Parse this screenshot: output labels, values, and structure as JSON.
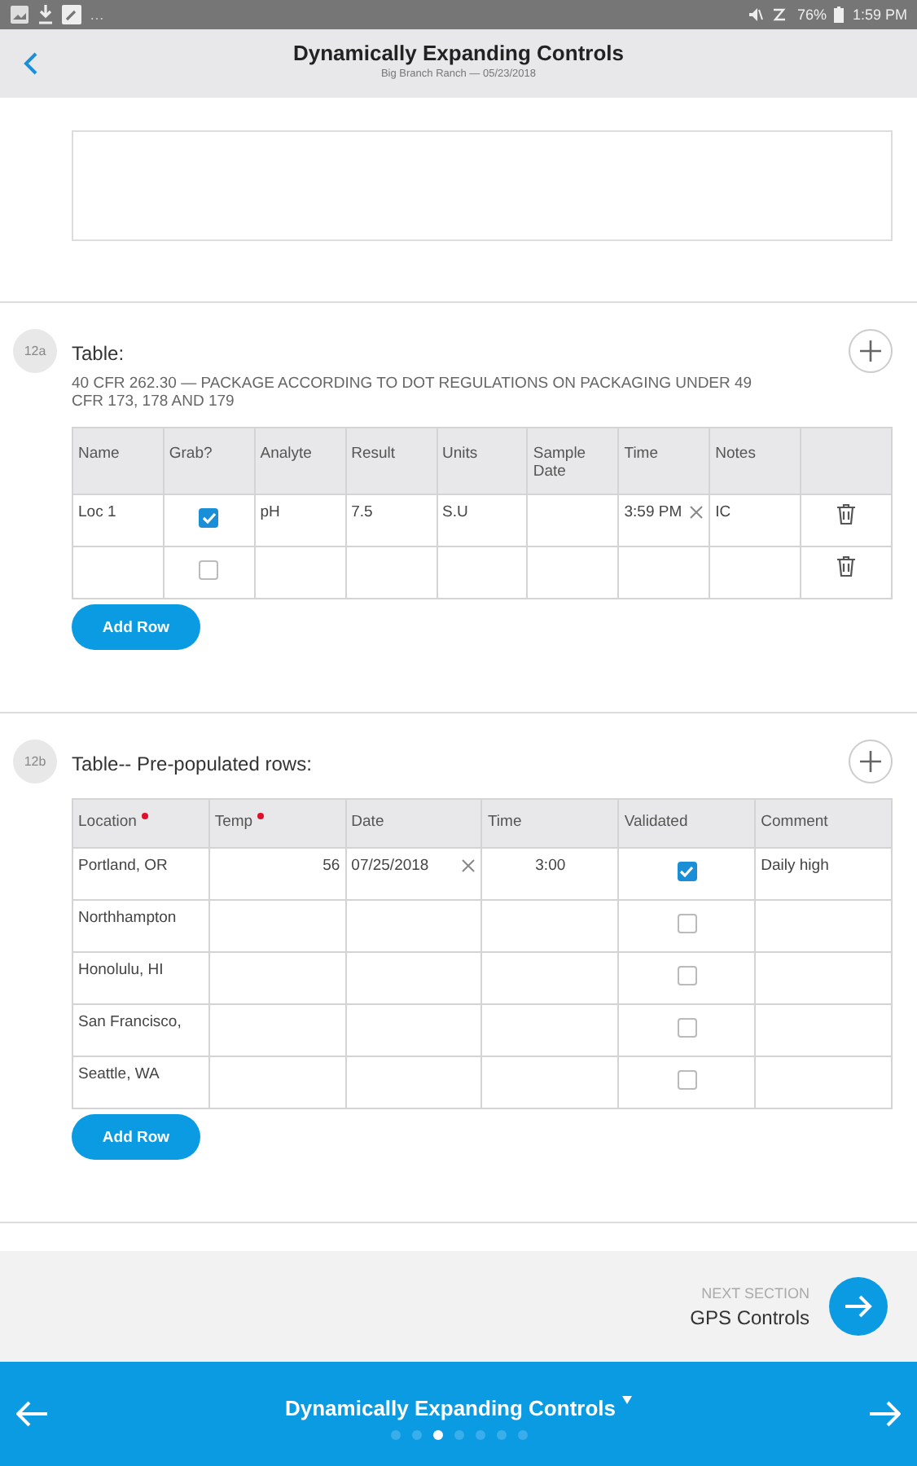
{
  "status_bar": {
    "notifications": "…",
    "battery": "76%",
    "time": "1:59 PM"
  },
  "header": {
    "title": "Dynamically Expanding Controls",
    "subtitle": "Big Branch Ranch — 05/23/2018"
  },
  "sections": [
    {
      "number": "12a",
      "title": "Table:",
      "description": "40 CFR 262.30 — PACKAGE ACCORDING TO DOT REGULATIONS ON PACKAGING UNDER 49 CFR 173, 178 AND 179",
      "deletable_rows": true,
      "columns": [
        {
          "label": "Name",
          "required": false
        },
        {
          "label": "Grab?",
          "required": false
        },
        {
          "label": "Analyte",
          "required": false
        },
        {
          "label": "Result",
          "required": false
        },
        {
          "label": "Units",
          "required": false
        },
        {
          "label": "Sample Date",
          "required": false
        },
        {
          "label": "Time",
          "required": false
        },
        {
          "label": "Notes",
          "required": false
        }
      ],
      "rows": [
        {
          "cells": [
            {
              "kind": "text",
              "value": "Loc 1"
            },
            {
              "kind": "checkbox",
              "checked": true
            },
            {
              "kind": "text",
              "value": "pH"
            },
            {
              "kind": "text",
              "value": "7.5"
            },
            {
              "kind": "text",
              "value": "S.U"
            },
            {
              "kind": "empty"
            },
            {
              "kind": "clearable",
              "value": "3:59 PM"
            },
            {
              "kind": "text",
              "value": "IC"
            }
          ]
        },
        {
          "cells": [
            {
              "kind": "empty"
            },
            {
              "kind": "checkbox",
              "checked": false
            },
            {
              "kind": "empty"
            },
            {
              "kind": "empty"
            },
            {
              "kind": "empty"
            },
            {
              "kind": "empty"
            },
            {
              "kind": "empty"
            },
            {
              "kind": "empty"
            }
          ]
        }
      ],
      "add_button": "Add Row"
    },
    {
      "number": "12b",
      "title": "Table-- Pre-populated rows:",
      "deletable_rows": false,
      "columns": [
        {
          "label": "Location",
          "required": true
        },
        {
          "label": "Temp",
          "required": true
        },
        {
          "label": "Date",
          "required": false
        },
        {
          "label": "Time",
          "required": false
        },
        {
          "label": "Validated",
          "required": false
        },
        {
          "label": "Comment",
          "required": false
        }
      ],
      "rows": [
        {
          "cells": [
            {
              "kind": "text",
              "value": "Portland, OR"
            },
            {
              "kind": "number",
              "value": "56"
            },
            {
              "kind": "clearable",
              "value": "07/25/2018"
            },
            {
              "kind": "centered",
              "value": "3:00"
            },
            {
              "kind": "checkbox",
              "checked": true
            },
            {
              "kind": "text",
              "value": "Daily high"
            }
          ]
        },
        {
          "cells": [
            {
              "kind": "text",
              "value": "Northhampton"
            },
            {
              "kind": "empty"
            },
            {
              "kind": "empty"
            },
            {
              "kind": "empty"
            },
            {
              "kind": "checkbox",
              "checked": false
            },
            {
              "kind": "empty"
            }
          ]
        },
        {
          "cells": [
            {
              "kind": "text",
              "value": "Honolulu, HI"
            },
            {
              "kind": "empty"
            },
            {
              "kind": "empty"
            },
            {
              "kind": "empty"
            },
            {
              "kind": "checkbox",
              "checked": false
            },
            {
              "kind": "empty"
            }
          ]
        },
        {
          "cells": [
            {
              "kind": "text",
              "value": "San Francisco,"
            },
            {
              "kind": "empty"
            },
            {
              "kind": "empty"
            },
            {
              "kind": "empty"
            },
            {
              "kind": "checkbox",
              "checked": false
            },
            {
              "kind": "empty"
            }
          ]
        },
        {
          "cells": [
            {
              "kind": "text",
              "value": "Seattle, WA"
            },
            {
              "kind": "empty"
            },
            {
              "kind": "empty"
            },
            {
              "kind": "empty"
            },
            {
              "kind": "checkbox",
              "checked": false
            },
            {
              "kind": "empty"
            }
          ]
        }
      ],
      "add_button": "Add Row"
    }
  ],
  "next_section": {
    "label": "NEXT SECTION",
    "title": "GPS Controls"
  },
  "bottom_nav": {
    "title": "Dynamically Expanding Controls",
    "pages": [
      {
        "selected": false
      },
      {
        "selected": false
      },
      {
        "selected": true
      },
      {
        "selected": false
      },
      {
        "selected": false
      },
      {
        "selected": false
      },
      {
        "selected": false
      }
    ]
  }
}
